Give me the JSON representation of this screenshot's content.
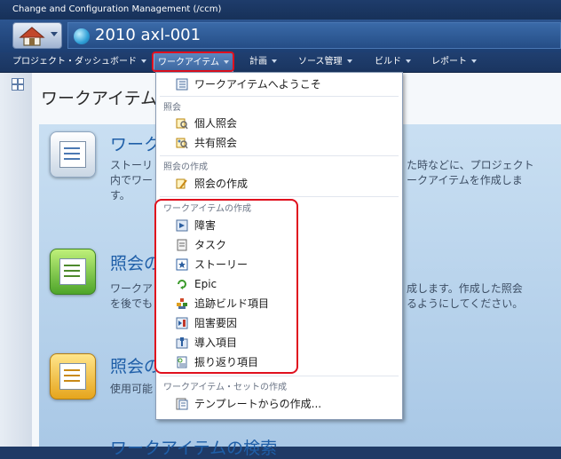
{
  "app": {
    "title": "Change and Configuration Management (/ccm)"
  },
  "project": {
    "name": "2010 axl-001"
  },
  "nav": {
    "items": [
      {
        "label": "プロジェクト・ダッシュボード"
      },
      {
        "label": "ワークアイテム"
      },
      {
        "label": "計画"
      },
      {
        "label": "ソース管理"
      },
      {
        "label": "ビルド"
      },
      {
        "label": "レポート"
      }
    ]
  },
  "page": {
    "title": "ワークアイテム",
    "sections": [
      {
        "heading": "ワーク",
        "lines": [
          "ストーリ",
          "内でワー",
          "す。"
        ],
        "lines_right": [
          "た時などに、プロジェクト",
          "ークアイテムを作成しま"
        ]
      },
      {
        "heading": "照会の",
        "lines": [
          "ワークア",
          "を後でも"
        ],
        "lines_right": [
          "成します。作成した照会",
          "るようにしてください。"
        ]
      },
      {
        "heading": "照会の",
        "lines": [
          "使用可能"
        ]
      },
      {
        "heading": "ワークアイテムの検索"
      }
    ]
  },
  "menu": {
    "welcome": "ワークアイテムへようこそ",
    "queries_header": "照会",
    "personal_query": "個人照会",
    "shared_query": "共有照会",
    "create_query_header": "照会の作成",
    "create_query": "照会の作成",
    "create_workitem_header": "ワークアイテムの作成",
    "types": [
      {
        "label": "障害",
        "icon": "defect-icon"
      },
      {
        "label": "タスク",
        "icon": "task-icon"
      },
      {
        "label": "ストーリー",
        "icon": "story-icon"
      },
      {
        "label": "Epic",
        "icon": "epic-icon"
      },
      {
        "label": "追跡ビルド項目",
        "icon": "track-build-icon"
      },
      {
        "label": "阻害要因",
        "icon": "impediment-icon"
      },
      {
        "label": "導入項目",
        "icon": "adoption-icon"
      },
      {
        "label": "振り返り項目",
        "icon": "retrospective-icon"
      }
    ],
    "workitem_set_header": "ワークアイテム・セットの作成",
    "from_template": "テンプレートからの作成..."
  },
  "colors": {
    "accent": "#1f5fa8",
    "highlight": "#e0101e",
    "header_bg": "#1e3c6b"
  }
}
